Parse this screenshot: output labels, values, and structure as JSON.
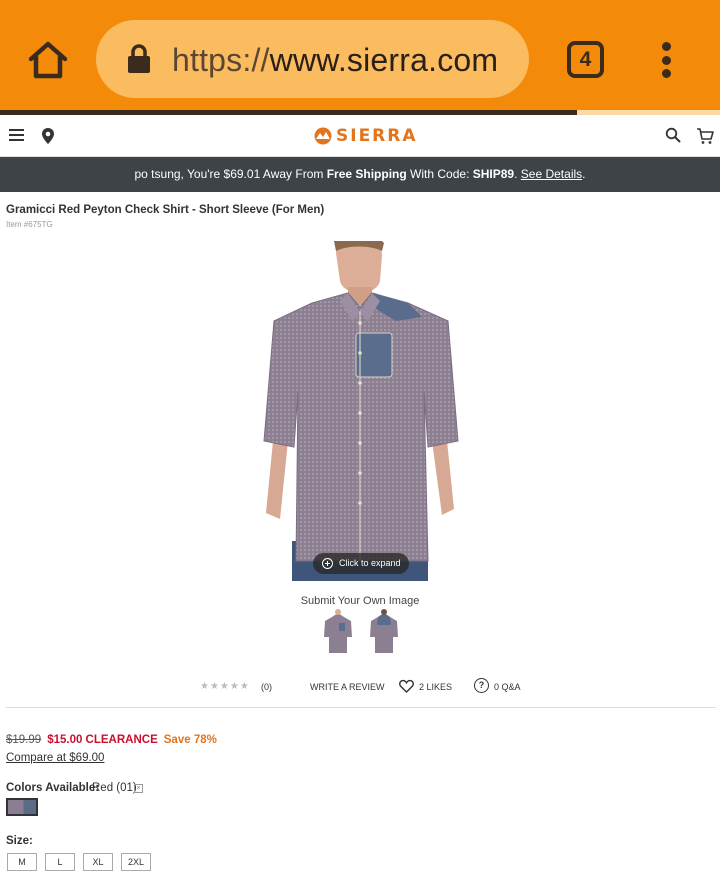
{
  "browser": {
    "url_scheme": "https://",
    "url_host": "www.sierra.com",
    "tab_count": "4"
  },
  "header": {
    "logo_text": "SIERRA"
  },
  "promo": {
    "text_before": "po tsung, You're $69.01 Away From ",
    "free_shipping": "Free Shipping",
    "text_mid": " With Code: ",
    "code": "SHIP89",
    "text_after": ". ",
    "see_details": "See Details",
    "end": "."
  },
  "product": {
    "title": "Gramicci Red Peyton Check Shirt - Short Sleeve (For Men)",
    "item_number": "Item #675TG",
    "expand_label": "Click to expand",
    "submit_image": "Submit Your Own Image",
    "thumbnails": [
      "front-view",
      "back-view"
    ]
  },
  "reviews": {
    "stars": "★★★★★",
    "rating_out_of": 5,
    "rating_value": 0,
    "count": "(0)",
    "write_review": "WRITE A REVIEW",
    "likes": "2 LIKES",
    "qa_icon": "?",
    "qa": "0 Q&A"
  },
  "pricing": {
    "old_price": "$19.99",
    "sale_price": "$15.00 CLEARANCE",
    "save": "Save 78%",
    "compare": "Compare at $69.00"
  },
  "colors": {
    "label": "Colors Available:",
    "selected": "Red (01)",
    "swatch_colors": [
      "#8b7d92",
      "#5b6b86"
    ]
  },
  "sizes": {
    "label": "Size:",
    "options": [
      "M",
      "L",
      "XL",
      "2XL"
    ]
  },
  "theme": {
    "chrome_orange": "#f48a09",
    "brand_orange": "#e2741d",
    "sale_red": "#c8102e",
    "banner_gray": "#3d4347"
  }
}
